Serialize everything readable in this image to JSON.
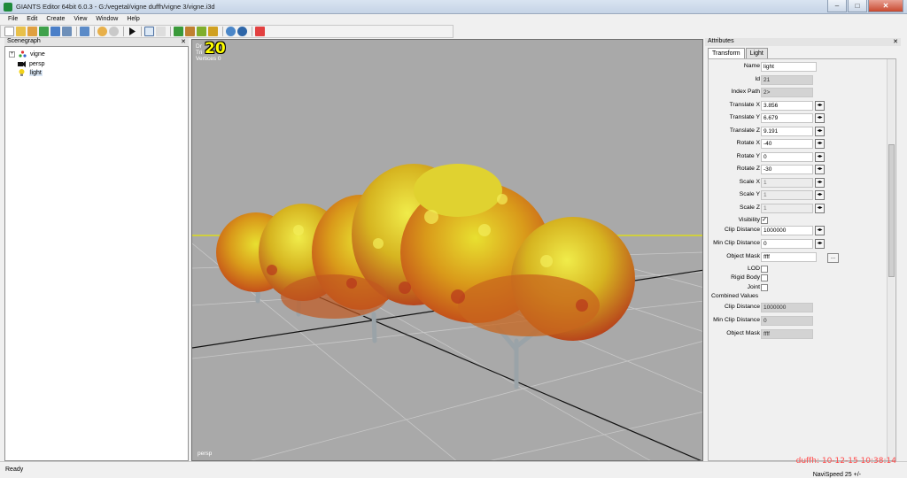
{
  "window": {
    "title": "GIANTS Editor 64bit 6.0.3 - G:/vegetal/vigne duffh/vigne 3/vigne.i3d",
    "minimize": "–",
    "maximize": "□",
    "close": "✕"
  },
  "menu": [
    "File",
    "Edit",
    "Create",
    "View",
    "Window",
    "Help"
  ],
  "toolbar_icons": [
    "new-icon",
    "open-icon",
    "save-icon",
    "reload-icon",
    "save-as-icon",
    "export-icon",
    "import-icon",
    "undo-icon",
    "redo-icon",
    "play-icon",
    "camera-icon",
    "lock-icon",
    "terrain-icon",
    "paint-icon",
    "foliage-icon",
    "settings-icon",
    "scene-icon",
    "record-icon"
  ],
  "scenegraph": {
    "title": "Scenegraph",
    "close": "✕",
    "items": [
      {
        "label": "vigne",
        "icon": "transform-group-icon",
        "expand": "+"
      },
      {
        "label": "persp",
        "icon": "camera-icon"
      },
      {
        "label": "light",
        "icon": "light-bulb-icon"
      }
    ]
  },
  "viewport": {
    "fps": "20",
    "info": [
      "Dr",
      "Tri",
      "Vertices 0"
    ],
    "camera": "persp"
  },
  "attributes": {
    "title": "Attributes",
    "close": "✕",
    "tabs": [
      "Transform",
      "Light"
    ],
    "fields": [
      {
        "label": "Name",
        "value": "light",
        "kind": "edit"
      },
      {
        "label": "Id",
        "value": "21",
        "kind": "ro"
      },
      {
        "label": "Index Path",
        "value": "2>",
        "kind": "ro"
      },
      {
        "label": "Translate X",
        "value": "3.856",
        "kind": "spin"
      },
      {
        "label": "Translate Y",
        "value": "6.679",
        "kind": "spin"
      },
      {
        "label": "Translate Z",
        "value": "9.191",
        "kind": "spin"
      },
      {
        "label": "Rotate X",
        "value": "-40",
        "kind": "spin"
      },
      {
        "label": "Rotate Y",
        "value": "0",
        "kind": "spin"
      },
      {
        "label": "Rotate Z",
        "value": "-30",
        "kind": "spin"
      },
      {
        "label": "Scale X",
        "value": "1",
        "kind": "dis"
      },
      {
        "label": "Scale Y",
        "value": "1",
        "kind": "dis"
      },
      {
        "label": "Scale Z",
        "value": "1",
        "kind": "dis"
      }
    ],
    "visibility": {
      "label": "Visibility",
      "checked": "✓"
    },
    "clip_distance": {
      "label": "Clip Distance",
      "value": "1000000"
    },
    "min_clip_distance": {
      "label": "Min Clip Distance",
      "value": "0"
    },
    "object_mask": {
      "label": "Object Mask",
      "value": "ffff",
      "more": "..."
    },
    "lod": "LOD",
    "rigid_body": "Rigid Body",
    "joint": "Joint",
    "combined_title": "Combined Values",
    "combined": [
      {
        "label": "Clip Distance",
        "value": "1000000"
      },
      {
        "label": "Min Clip Distance",
        "value": "0"
      },
      {
        "label": "Object Mask",
        "value": "ffff"
      }
    ],
    "spin_glyph": "◂▸"
  },
  "status": {
    "left": "Ready",
    "right": "NaviSpeed 25 +/-"
  },
  "watermark": "duffh: 10-12-15 10:38:14"
}
